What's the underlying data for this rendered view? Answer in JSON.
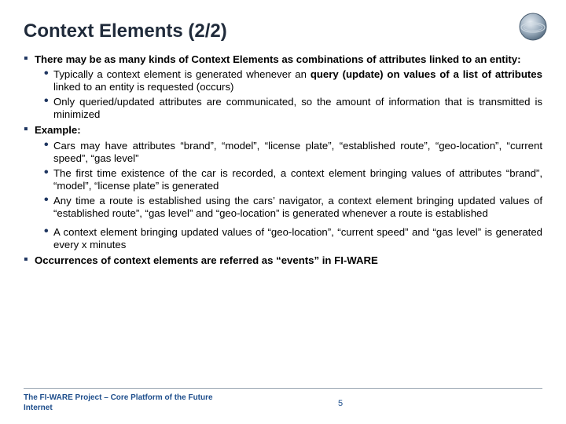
{
  "title": "Context Elements (2/2)",
  "main": {
    "p1": "There may be as many kinds of Context Elements as combinations of attributes  linked to an entity:",
    "p1_a": "Typically a context element is generated whenever an <b>query (update) on values of a list of attributes</b> linked to an entity is requested (occurs)",
    "p1_b": "Only queried/updated attributes are communicated, so the amount of information that is transmitted is minimized",
    "p2": "Example:",
    "p2_a": "Cars may have attributes “brand”, “model”, “license plate”, “established route”, “geo-location”, “current speed”, “gas level”",
    "p2_b": "The first time existence of the car is recorded, a context element bringing values of attributes “brand”, “model”, “license plate” is generated",
    "p2_c": "Any time a route is established using the cars’ navigator, a context element bringing updated values of “established route”, “gas level” and “geo-location” is generated whenever a route is established",
    "p2_d": "A context element bringing updated values of “geo-location”, “current speed” and “gas level” is generated every x minutes",
    "p3": "Occurrences of context elements are referred as “<b>events</b>” in FI-WARE"
  },
  "footer": {
    "project": "The FI-WARE Project – Core Platform of the Future Internet",
    "page": "5"
  }
}
